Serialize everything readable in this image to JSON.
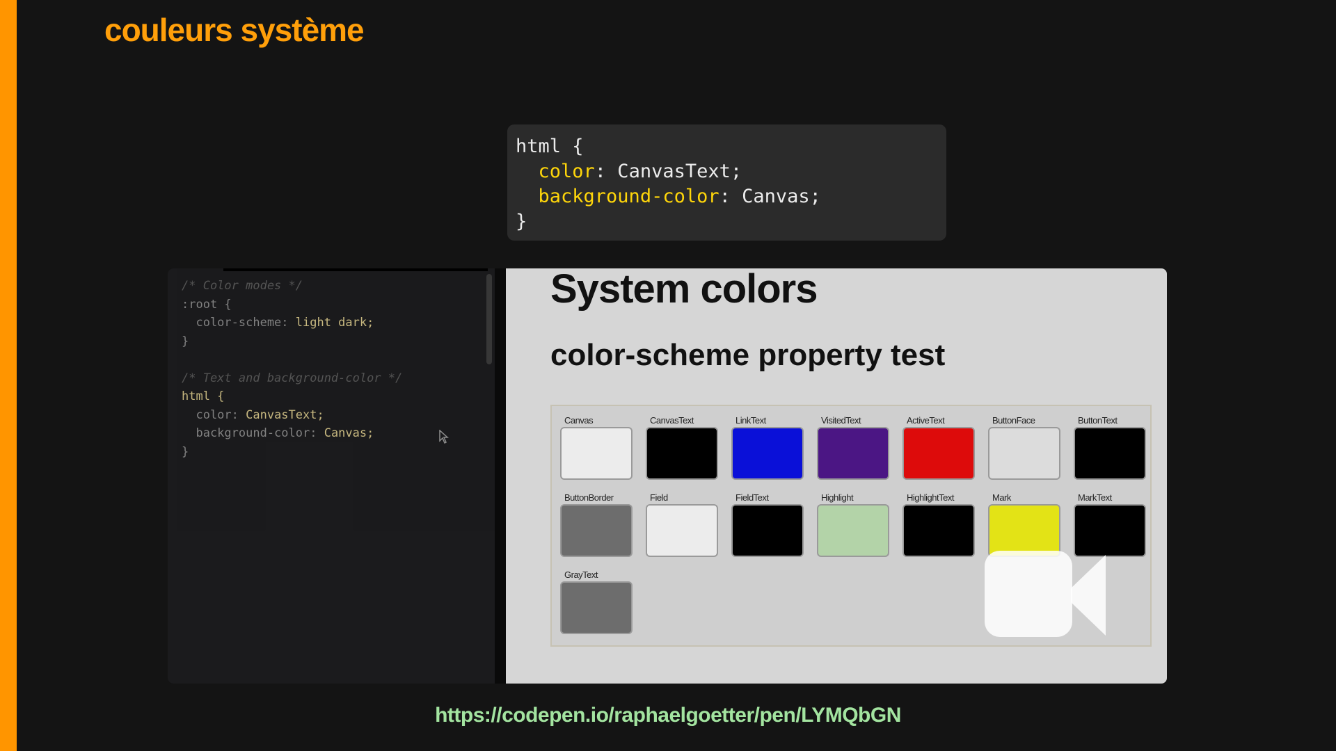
{
  "slide": {
    "title": "couleurs système",
    "link": "https://codepen.io/raphaelgoetter/pen/LYMQbGN"
  },
  "code_card": {
    "lines": [
      {
        "a": "html {",
        "prop": "",
        "b": ""
      },
      {
        "a": "  ",
        "prop": "color",
        "b": ": CanvasText;"
      },
      {
        "a": "  ",
        "prop": "background-color",
        "b": ": Canvas;"
      },
      {
        "a": "}",
        "prop": "",
        "b": ""
      }
    ]
  },
  "editor": {
    "lines": [
      {
        "cls": "cm",
        "text": "/* Color modes */"
      },
      {
        "cls": "",
        "text": ":root {"
      },
      {
        "cls": "",
        "text": "  color-scheme: ",
        "val": "light dark;"
      },
      {
        "cls": "",
        "text": "}"
      },
      {
        "cls": "",
        "text": ""
      },
      {
        "cls": "cm",
        "text": "/* Text and background-color */"
      },
      {
        "cls": "kw",
        "text": "html {"
      },
      {
        "cls": "",
        "text": "  color: ",
        "val": "CanvasText;"
      },
      {
        "cls": "",
        "text": "  background-color: ",
        "val": "Canvas;"
      },
      {
        "cls": "",
        "text": "}"
      }
    ]
  },
  "preview": {
    "heading": "System colors",
    "subheading": "color-scheme property test",
    "swatches": [
      {
        "label": "Canvas",
        "color": "#ececec"
      },
      {
        "label": "CanvasText",
        "color": "#000000"
      },
      {
        "label": "LinkText",
        "color": "#0a10d8"
      },
      {
        "label": "VisitedText",
        "color": "#4b1684"
      },
      {
        "label": "ActiveText",
        "color": "#dd0b0b"
      },
      {
        "label": "ButtonFace",
        "color": "#dcdcdc"
      },
      {
        "label": "ButtonText",
        "color": "#000000"
      },
      {
        "label": "ButtonBorder",
        "color": "#6d6d6d"
      },
      {
        "label": "Field",
        "color": "#ececec"
      },
      {
        "label": "FieldText",
        "color": "#000000"
      },
      {
        "label": "Highlight",
        "color": "#b3d3a8"
      },
      {
        "label": "HighlightText",
        "color": "#000000"
      },
      {
        "label": "Mark",
        "color": "#e3e316"
      },
      {
        "label": "MarkText",
        "color": "#000000"
      },
      {
        "label": "GrayText",
        "color": "#6d6d6d"
      }
    ]
  },
  "icons": {
    "video": "video-camera-icon",
    "cursor": "mouse-pointer-icon"
  },
  "colors": {
    "accent": "#ff9500",
    "link": "#a3e4a0",
    "code_property": "#ffd60a"
  }
}
